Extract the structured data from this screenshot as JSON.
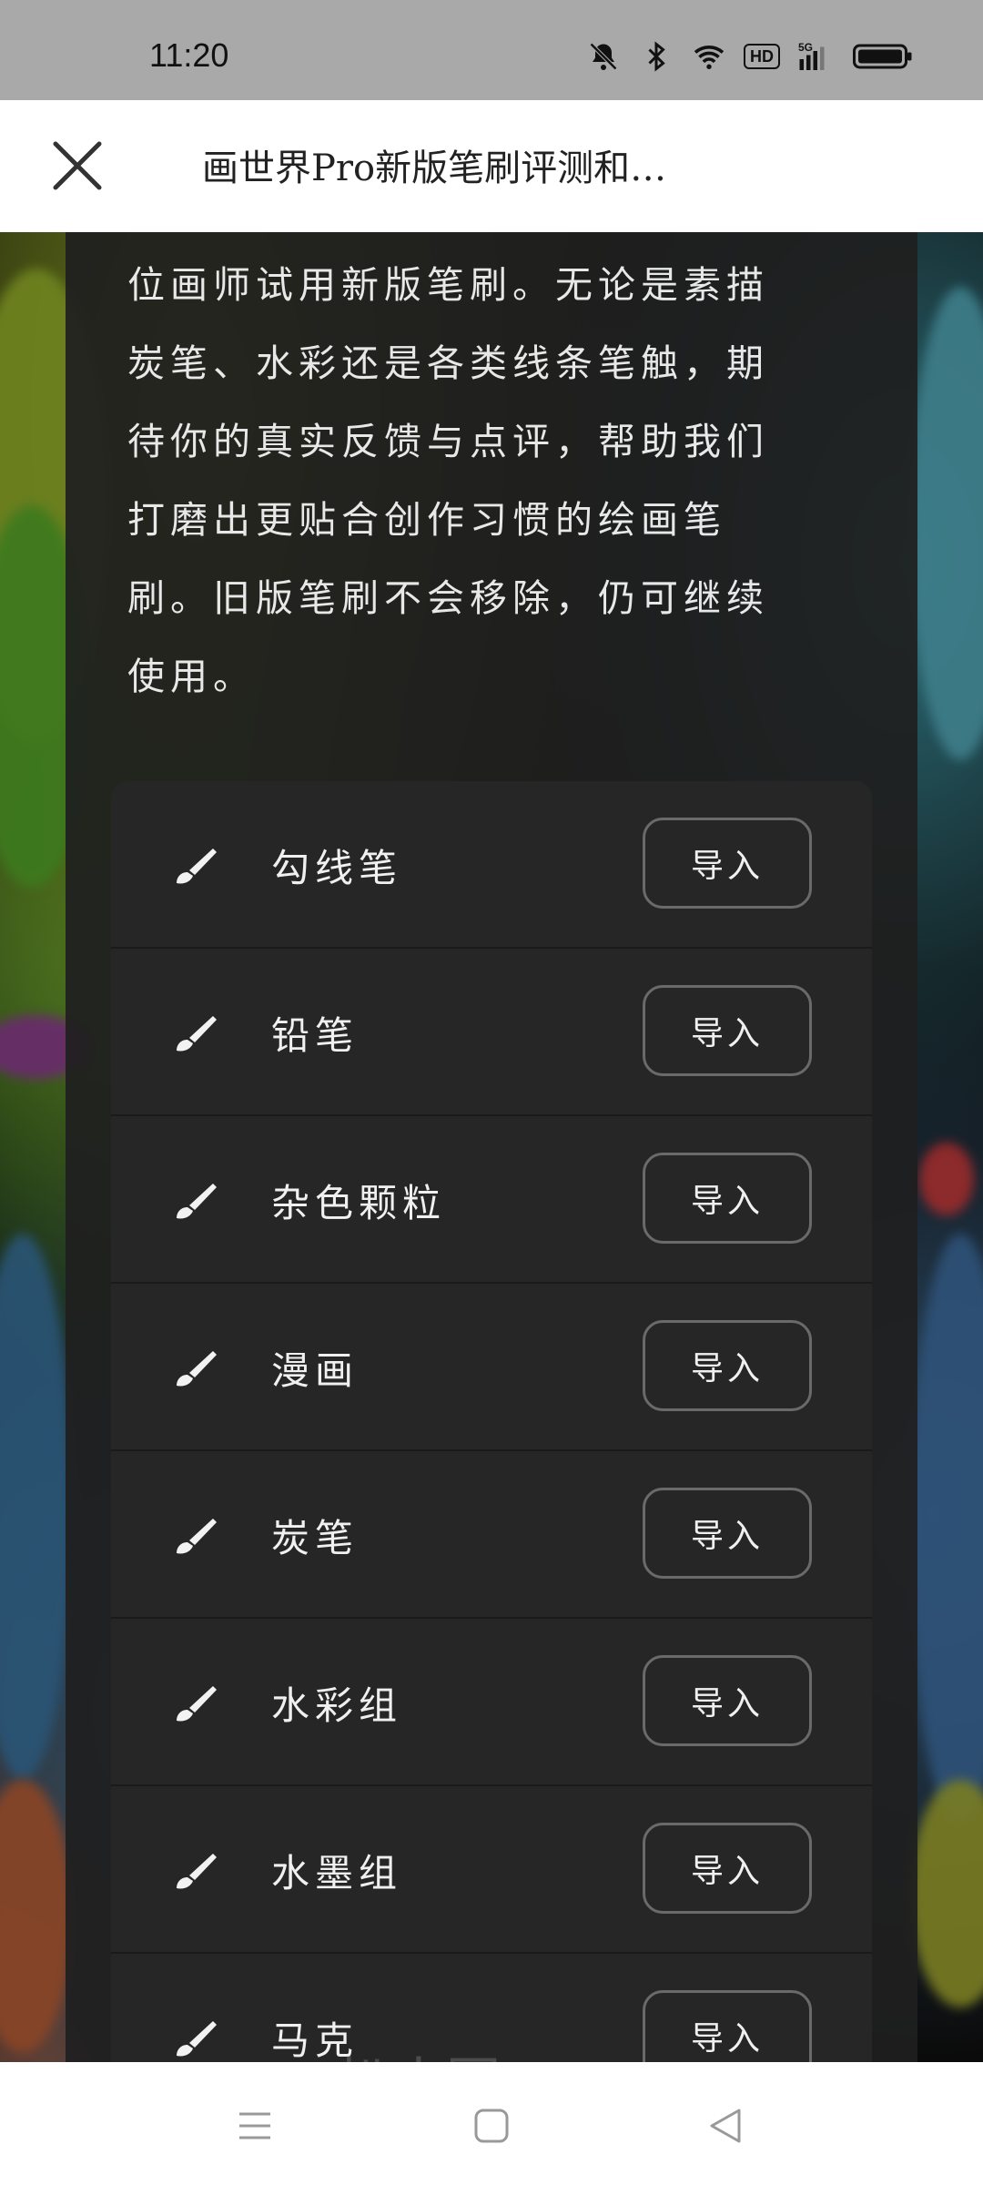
{
  "status_bar": {
    "time": "11:20",
    "icons": [
      "mute-icon",
      "bluetooth-icon",
      "wifi-icon",
      "hd-icon",
      "5g-signal-icon",
      "battery-icon"
    ],
    "hd_label": "HD"
  },
  "header": {
    "title": "画世界Pro新版笔刷评测和…",
    "close_icon": "close-icon"
  },
  "description": "位画师试用新版笔刷。无论是素描炭笔、水彩还是各类线条笔触，期待你的真实反馈与点评，帮助我们打磨出更贴合创作习惯的绘画笔刷。旧版笔刷不会移除，仍可继续使用。",
  "brush_list": {
    "items": [
      {
        "name": "勾线笔",
        "action": "导入"
      },
      {
        "name": "铅笔",
        "action": "导入"
      },
      {
        "name": "杂色颗粒",
        "action": "导入"
      },
      {
        "name": "漫画",
        "action": "导入"
      },
      {
        "name": "炭笔",
        "action": "导入"
      },
      {
        "name": "水彩组",
        "action": "导入"
      },
      {
        "name": "水墨组",
        "action": "导入"
      },
      {
        "name": "马克",
        "action": "导入"
      }
    ]
  },
  "watermark": "扒人圈 ch.baicsi.cn",
  "nav": {
    "icons": [
      "menu-icon",
      "home-icon",
      "back-icon"
    ]
  }
}
